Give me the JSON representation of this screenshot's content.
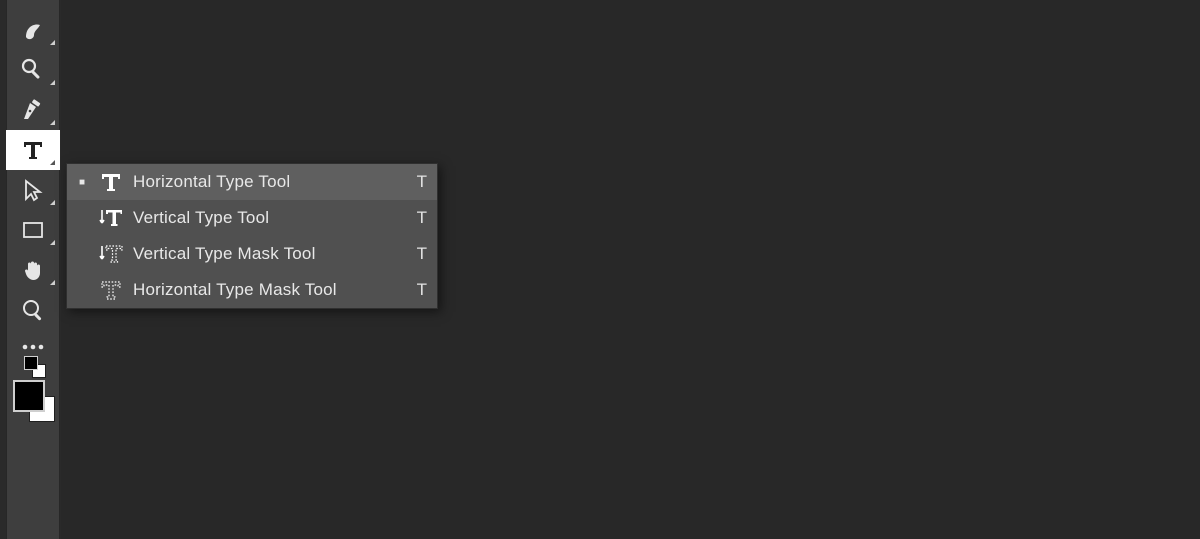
{
  "toolbar": {
    "tools": [
      {
        "name": "smudge-tool"
      },
      {
        "name": "dodge-tool"
      },
      {
        "name": "pen-tool"
      },
      {
        "name": "type-tool"
      },
      {
        "name": "path-selection-tool"
      },
      {
        "name": "rectangle-shape-tool"
      },
      {
        "name": "hand-tool"
      },
      {
        "name": "zoom-tool"
      },
      {
        "name": "more-tools"
      }
    ],
    "selected_index": 3,
    "swatch": {
      "fg": "#000000",
      "bg": "#ffffff"
    }
  },
  "flyout": {
    "items": [
      {
        "icon": "horizontal-type-icon",
        "label": "Horizontal Type Tool",
        "shortcut": "T",
        "selected": true
      },
      {
        "icon": "vertical-type-icon",
        "label": "Vertical Type Tool",
        "shortcut": "T",
        "selected": false
      },
      {
        "icon": "vertical-type-mask-icon",
        "label": "Vertical Type Mask Tool",
        "shortcut": "T",
        "selected": false
      },
      {
        "icon": "horizontal-type-mask-icon",
        "label": "Horizontal Type Mask Tool",
        "shortcut": "T",
        "selected": false
      }
    ]
  }
}
